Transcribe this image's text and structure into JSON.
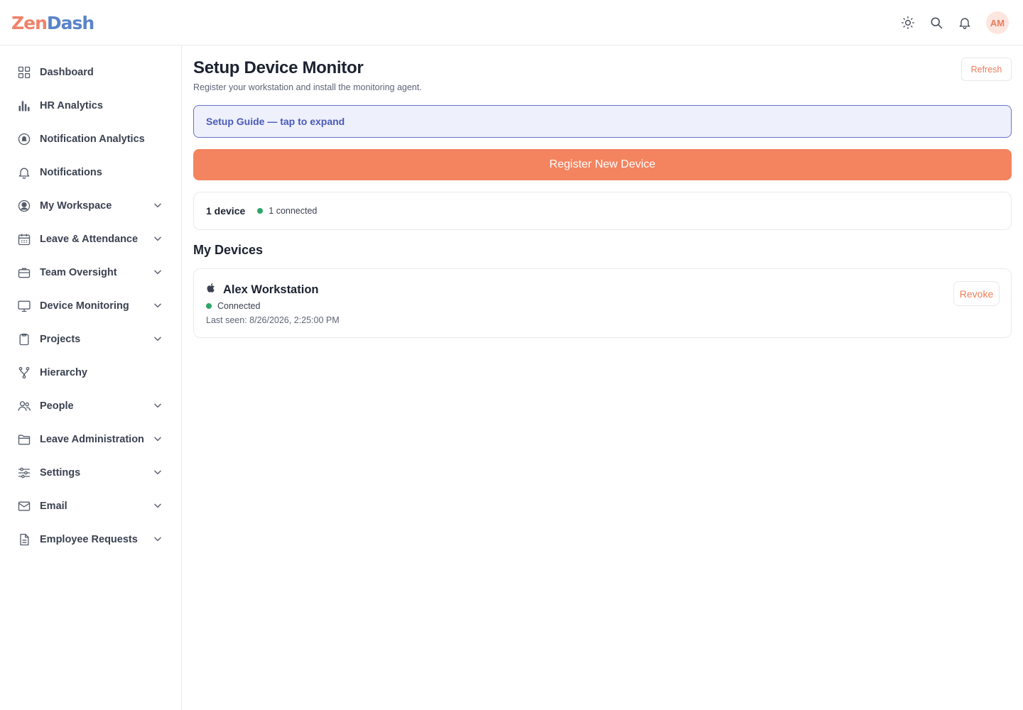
{
  "brand": {
    "logo_part1": "Zen",
    "logo_part2": "Dash",
    "accent": "#f3845f"
  },
  "header": {
    "icons": [
      "sun-icon",
      "search-icon",
      "bell-icon"
    ],
    "avatar_initials": "AM"
  },
  "sidebar": {
    "items": [
      {
        "label": "Dashboard",
        "icon": "grid-icon",
        "expandable": false
      },
      {
        "label": "HR Analytics",
        "icon": "bar-chart-icon",
        "expandable": false
      },
      {
        "label": "Notification Analytics",
        "icon": "notification-analytics-icon",
        "expandable": false
      },
      {
        "label": "Notifications",
        "icon": "bell-icon",
        "expandable": false
      },
      {
        "label": "My Workspace",
        "icon": "user-circle-icon",
        "expandable": true
      },
      {
        "label": "Leave & Attendance",
        "icon": "calendar-icon",
        "expandable": true
      },
      {
        "label": "Team Oversight",
        "icon": "briefcase-icon",
        "expandable": true
      },
      {
        "label": "Device Monitoring",
        "icon": "monitor-icon",
        "expandable": true
      },
      {
        "label": "Projects",
        "icon": "clipboard-icon",
        "expandable": true
      },
      {
        "label": "Hierarchy",
        "icon": "hierarchy-icon",
        "expandable": false
      },
      {
        "label": "People",
        "icon": "people-icon",
        "expandable": true
      },
      {
        "label": "Leave Administration",
        "icon": "folder-icon",
        "expandable": true
      },
      {
        "label": "Settings",
        "icon": "sliders-icon",
        "expandable": true
      },
      {
        "label": "Email",
        "icon": "mail-icon",
        "expandable": true
      },
      {
        "label": "Employee Requests",
        "icon": "document-icon",
        "expandable": true
      }
    ]
  },
  "main": {
    "title": "Setup Device Monitor",
    "subtitle": "Register your workstation and install the monitoring agent.",
    "refresh_label": "Refresh",
    "guide_label": "Setup Guide — tap to expand",
    "register_label": "Register New Device",
    "summary": {
      "count_label": "1 device",
      "connected_label": "1 connected"
    },
    "section_title": "My Devices",
    "devices": [
      {
        "name": "Alex Workstation",
        "os_icon": "apple-icon",
        "status": "Connected",
        "last_seen": "Last seen: 8/26/2026, 2:25:00 PM",
        "revoke_label": "Revoke"
      }
    ]
  }
}
